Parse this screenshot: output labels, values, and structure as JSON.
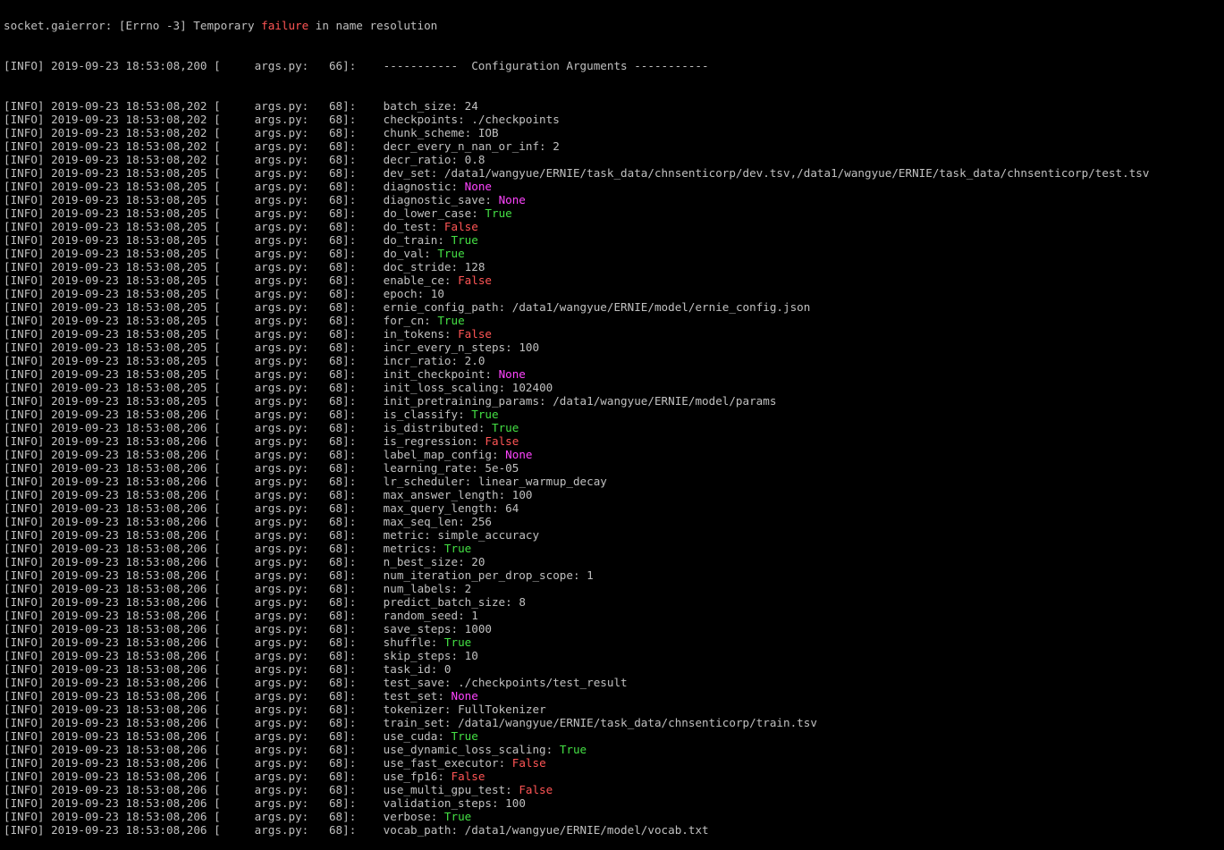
{
  "terminal": {
    "first_line": {
      "prefix": "socket.gaierror: [Errno -3] Temporary ",
      "failure_word": "failure",
      "suffix": " in name resolution"
    },
    "header": {
      "level": "[INFO]",
      "timestamp": "2019-09-23 18:53:08,200",
      "location": "[     args.py:   66]:",
      "text": "-----------  Configuration Arguments -----------"
    },
    "level": "[INFO]",
    "location": "[     args.py:   68]:",
    "entries": [
      {
        "ts": "2019-09-23 18:53:08,202",
        "key": "batch_size",
        "value": "24",
        "type": "plain"
      },
      {
        "ts": "2019-09-23 18:53:08,202",
        "key": "checkpoints",
        "value": "./checkpoints",
        "type": "plain"
      },
      {
        "ts": "2019-09-23 18:53:08,202",
        "key": "chunk_scheme",
        "value": "IOB",
        "type": "plain"
      },
      {
        "ts": "2019-09-23 18:53:08,202",
        "key": "decr_every_n_nan_or_inf",
        "value": "2",
        "type": "plain"
      },
      {
        "ts": "2019-09-23 18:53:08,202",
        "key": "decr_ratio",
        "value": "0.8",
        "type": "plain"
      },
      {
        "ts": "2019-09-23 18:53:08,205",
        "key": "dev_set",
        "value": "/data1/wangyue/ERNIE/task_data/chnsenticorp/dev.tsv,/data1/wangyue/ERNIE/task_data/chnsenticorp/test.tsv",
        "type": "plain"
      },
      {
        "ts": "2019-09-23 18:53:08,205",
        "key": "diagnostic",
        "value": "None",
        "type": "none"
      },
      {
        "ts": "2019-09-23 18:53:08,205",
        "key": "diagnostic_save",
        "value": "None",
        "type": "none"
      },
      {
        "ts": "2019-09-23 18:53:08,205",
        "key": "do_lower_case",
        "value": "True",
        "type": "true"
      },
      {
        "ts": "2019-09-23 18:53:08,205",
        "key": "do_test",
        "value": "False",
        "type": "false"
      },
      {
        "ts": "2019-09-23 18:53:08,205",
        "key": "do_train",
        "value": "True",
        "type": "true"
      },
      {
        "ts": "2019-09-23 18:53:08,205",
        "key": "do_val",
        "value": "True",
        "type": "true"
      },
      {
        "ts": "2019-09-23 18:53:08,205",
        "key": "doc_stride",
        "value": "128",
        "type": "plain"
      },
      {
        "ts": "2019-09-23 18:53:08,205",
        "key": "enable_ce",
        "value": "False",
        "type": "false"
      },
      {
        "ts": "2019-09-23 18:53:08,205",
        "key": "epoch",
        "value": "10",
        "type": "plain"
      },
      {
        "ts": "2019-09-23 18:53:08,205",
        "key": "ernie_config_path",
        "value": "/data1/wangyue/ERNIE/model/ernie_config.json",
        "type": "plain"
      },
      {
        "ts": "2019-09-23 18:53:08,205",
        "key": "for_cn",
        "value": "True",
        "type": "true"
      },
      {
        "ts": "2019-09-23 18:53:08,205",
        "key": "in_tokens",
        "value": "False",
        "type": "false"
      },
      {
        "ts": "2019-09-23 18:53:08,205",
        "key": "incr_every_n_steps",
        "value": "100",
        "type": "plain"
      },
      {
        "ts": "2019-09-23 18:53:08,205",
        "key": "incr_ratio",
        "value": "2.0",
        "type": "plain"
      },
      {
        "ts": "2019-09-23 18:53:08,205",
        "key": "init_checkpoint",
        "value": "None",
        "type": "none"
      },
      {
        "ts": "2019-09-23 18:53:08,205",
        "key": "init_loss_scaling",
        "value": "102400",
        "type": "plain"
      },
      {
        "ts": "2019-09-23 18:53:08,205",
        "key": "init_pretraining_params",
        "value": "/data1/wangyue/ERNIE/model/params",
        "type": "plain"
      },
      {
        "ts": "2019-09-23 18:53:08,206",
        "key": "is_classify",
        "value": "True",
        "type": "true"
      },
      {
        "ts": "2019-09-23 18:53:08,206",
        "key": "is_distributed",
        "value": "True",
        "type": "true"
      },
      {
        "ts": "2019-09-23 18:53:08,206",
        "key": "is_regression",
        "value": "False",
        "type": "false"
      },
      {
        "ts": "2019-09-23 18:53:08,206",
        "key": "label_map_config",
        "value": "None",
        "type": "none"
      },
      {
        "ts": "2019-09-23 18:53:08,206",
        "key": "learning_rate",
        "value": "5e-05",
        "type": "plain"
      },
      {
        "ts": "2019-09-23 18:53:08,206",
        "key": "lr_scheduler",
        "value": "linear_warmup_decay",
        "type": "plain"
      },
      {
        "ts": "2019-09-23 18:53:08,206",
        "key": "max_answer_length",
        "value": "100",
        "type": "plain"
      },
      {
        "ts": "2019-09-23 18:53:08,206",
        "key": "max_query_length",
        "value": "64",
        "type": "plain"
      },
      {
        "ts": "2019-09-23 18:53:08,206",
        "key": "max_seq_len",
        "value": "256",
        "type": "plain"
      },
      {
        "ts": "2019-09-23 18:53:08,206",
        "key": "metric",
        "value": "simple_accuracy",
        "type": "plain"
      },
      {
        "ts": "2019-09-23 18:53:08,206",
        "key": "metrics",
        "value": "True",
        "type": "true"
      },
      {
        "ts": "2019-09-23 18:53:08,206",
        "key": "n_best_size",
        "value": "20",
        "type": "plain"
      },
      {
        "ts": "2019-09-23 18:53:08,206",
        "key": "num_iteration_per_drop_scope",
        "value": "1",
        "type": "plain"
      },
      {
        "ts": "2019-09-23 18:53:08,206",
        "key": "num_labels",
        "value": "2",
        "type": "plain"
      },
      {
        "ts": "2019-09-23 18:53:08,206",
        "key": "predict_batch_size",
        "value": "8",
        "type": "plain"
      },
      {
        "ts": "2019-09-23 18:53:08,206",
        "key": "random_seed",
        "value": "1",
        "type": "plain"
      },
      {
        "ts": "2019-09-23 18:53:08,206",
        "key": "save_steps",
        "value": "1000",
        "type": "plain"
      },
      {
        "ts": "2019-09-23 18:53:08,206",
        "key": "shuffle",
        "value": "True",
        "type": "true"
      },
      {
        "ts": "2019-09-23 18:53:08,206",
        "key": "skip_steps",
        "value": "10",
        "type": "plain"
      },
      {
        "ts": "2019-09-23 18:53:08,206",
        "key": "task_id",
        "value": "0",
        "type": "plain"
      },
      {
        "ts": "2019-09-23 18:53:08,206",
        "key": "test_save",
        "value": "./checkpoints/test_result",
        "type": "plain"
      },
      {
        "ts": "2019-09-23 18:53:08,206",
        "key": "test_set",
        "value": "None",
        "type": "none"
      },
      {
        "ts": "2019-09-23 18:53:08,206",
        "key": "tokenizer",
        "value": "FullTokenizer",
        "type": "plain"
      },
      {
        "ts": "2019-09-23 18:53:08,206",
        "key": "train_set",
        "value": "/data1/wangyue/ERNIE/task_data/chnsenticorp/train.tsv",
        "type": "plain"
      },
      {
        "ts": "2019-09-23 18:53:08,206",
        "key": "use_cuda",
        "value": "True",
        "type": "true"
      },
      {
        "ts": "2019-09-23 18:53:08,206",
        "key": "use_dynamic_loss_scaling",
        "value": "True",
        "type": "true"
      },
      {
        "ts": "2019-09-23 18:53:08,206",
        "key": "use_fast_executor",
        "value": "False",
        "type": "false"
      },
      {
        "ts": "2019-09-23 18:53:08,206",
        "key": "use_fp16",
        "value": "False",
        "type": "false"
      },
      {
        "ts": "2019-09-23 18:53:08,206",
        "key": "use_multi_gpu_test",
        "value": "False",
        "type": "false"
      },
      {
        "ts": "2019-09-23 18:53:08,206",
        "key": "validation_steps",
        "value": "100",
        "type": "plain"
      },
      {
        "ts": "2019-09-23 18:53:08,206",
        "key": "verbose",
        "value": "True",
        "type": "true"
      },
      {
        "ts": "2019-09-23 18:53:08,206",
        "key": "vocab_path",
        "value": "/data1/wangyue/ERNIE/model/vocab.txt",
        "type": "plain"
      }
    ]
  },
  "colors": {
    "background": "#000000",
    "text": "#c0c0c0",
    "none_value": "#ff44ff",
    "true_value": "#44e044",
    "false_value": "#ff5555"
  }
}
